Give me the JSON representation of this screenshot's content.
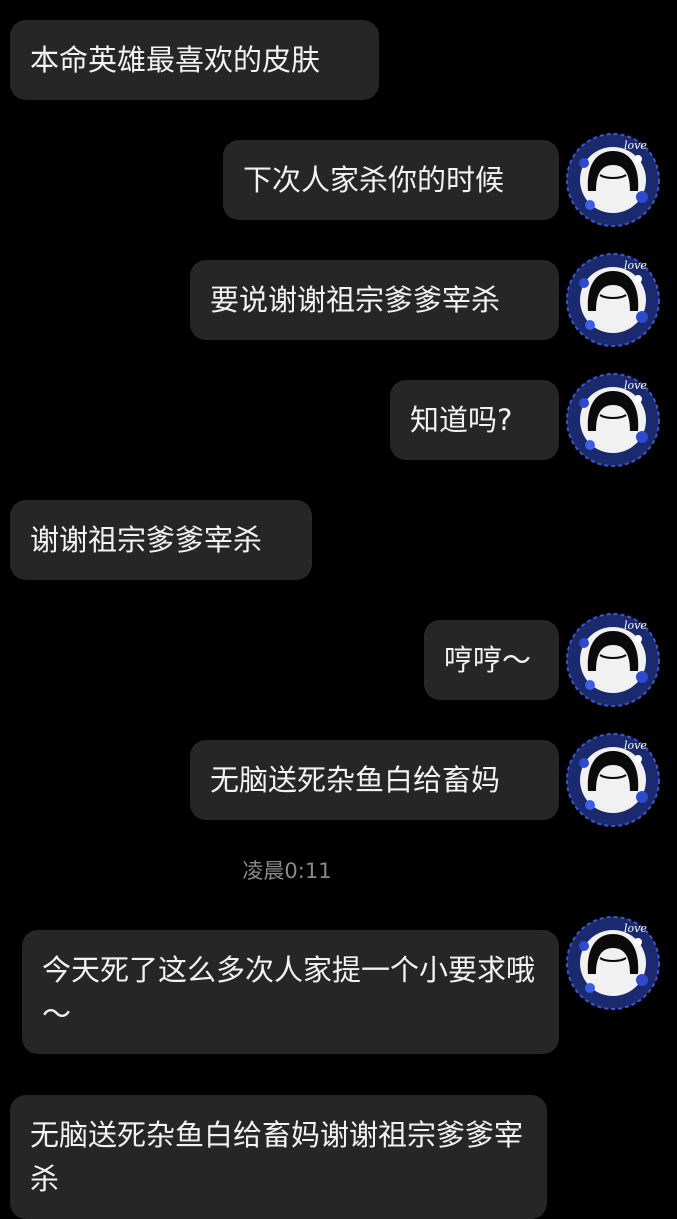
{
  "avatar_icon": "user-avatar-icon",
  "avatar_love_text": "love",
  "messages": [
    {
      "side": "left",
      "text": "本命英雄最喜欢的皮肤"
    },
    {
      "side": "right",
      "text": "下次人家杀你的时候"
    },
    {
      "side": "right",
      "text": "要说谢谢祖宗爹爹宰杀"
    },
    {
      "side": "right",
      "text": "知道吗?"
    },
    {
      "side": "left",
      "text": "谢谢祖宗爹爹宰杀"
    },
    {
      "side": "right",
      "text": "哼哼～"
    },
    {
      "side": "right",
      "text": "无脑送死杂鱼白给畜妈"
    },
    {
      "side": "right",
      "text": "今天死了这么多次人家提一个小要求哦～"
    },
    {
      "side": "left",
      "text": "无脑送死杂鱼白给畜妈谢谢祖宗爹爹宰杀"
    }
  ],
  "timestamp": "凌晨0:11",
  "colors": {
    "background": "#000000",
    "bubble": "#262626",
    "text": "#f2f2f2",
    "timestamp": "#8a8a8a"
  }
}
